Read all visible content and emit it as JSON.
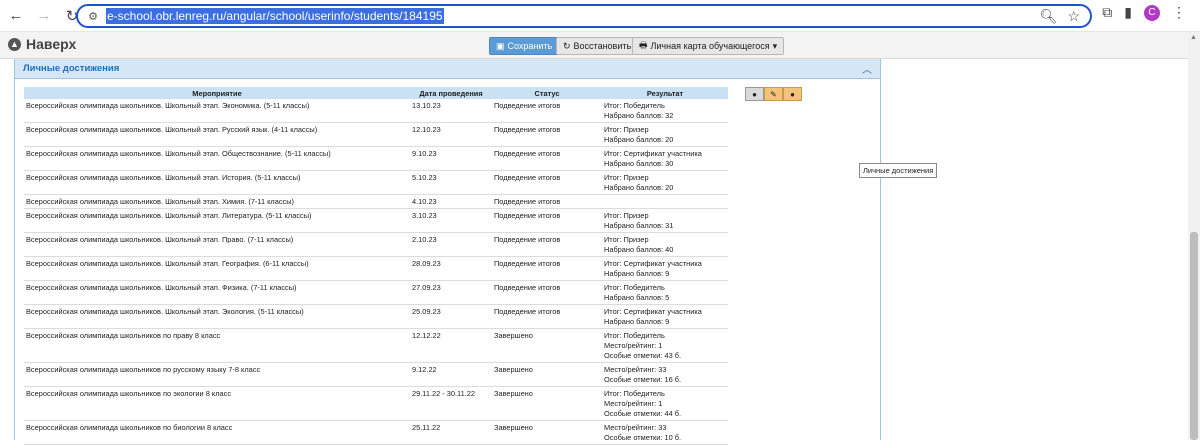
{
  "browser": {
    "url": "e-school.obr.lenreg.ru/angular/school/userinfo/students/184195",
    "avatar_letter": "C"
  },
  "topbar": {
    "back_label": "Наверх",
    "save_label": "Сохранить",
    "restore_label": "Восстановить",
    "card_label": "Личная карта обучающегося"
  },
  "panel": {
    "title": "Личные достижения",
    "columns": [
      "Мероприятие",
      "Дата проведения",
      "Статус",
      "Результат"
    ],
    "rows": [
      {
        "event": "Всероссийская олимпиада школьников. Школьный этап. Экономика. (5-11 классы)",
        "date": "13.10.23",
        "status": "Подведение итогов",
        "result": [
          "Итог: Победитель",
          "Набрано баллов: 32"
        ]
      },
      {
        "event": "Всероссийская олимпиада школьников. Школьный этап. Русский язык. (4-11 классы)",
        "date": "12.10.23",
        "status": "Подведение итогов",
        "result": [
          "Итог: Призер",
          "Набрано баллов: 20"
        ]
      },
      {
        "event": "Всероссийская олимпиада школьников. Школьный этап. Обществознание. (5-11 классы)",
        "date": "9.10.23",
        "status": "Подведение итогов",
        "result": [
          "Итог: Сертификат участника",
          "Набрано баллов: 30"
        ]
      },
      {
        "event": "Всероссийская олимпиада школьников. Школьный этап. История. (5-11 классы)",
        "date": "5.10.23",
        "status": "Подведение итогов",
        "result": [
          "Итог: Призер",
          "Набрано баллов: 20"
        ]
      },
      {
        "event": "Всероссийская олимпиада школьников. Школьный этап. Химия. (7-11 классы)",
        "date": "4.10.23",
        "status": "Подведение итогов",
        "result": []
      },
      {
        "event": "Всероссийская олимпиада школьников. Школьный этап. Литература. (5-11 классы)",
        "date": "3.10.23",
        "status": "Подведение итогов",
        "result": [
          "Итог: Призер",
          "Набрано баллов: 31"
        ]
      },
      {
        "event": "Всероссийская олимпиада школьников. Школьный этап. Право. (7-11 классы)",
        "date": "2.10.23",
        "status": "Подведение итогов",
        "result": [
          "Итог: Призер",
          "Набрано баллов: 40"
        ]
      },
      {
        "event": "Всероссийская олимпиада школьников. Школьный этап. География. (6-11 классы)",
        "date": "28.09.23",
        "status": "Подведение итогов",
        "result": [
          "Итог: Сертификат участника",
          "Набрано баллов: 9"
        ]
      },
      {
        "event": "Всероссийская олимпиада школьников. Школьный этап. Физика. (7-11 классы)",
        "date": "27.09.23",
        "status": "Подведение итогов",
        "result": [
          "Итог: Победитель",
          "Набрано баллов: 5"
        ]
      },
      {
        "event": "Всероссийская олимпиада школьников. Школьный этап. Экология. (5-11 классы)",
        "date": "25.09.23",
        "status": "Подведение итогов",
        "result": [
          "Итог: Сертификат участника",
          "Набрано баллов: 9"
        ]
      },
      {
        "event": "Всероссийская олимпиада школьников по праву 8 класс",
        "date": "12.12.22",
        "status": "Завершено",
        "result": [
          "Итог: Победитель",
          "Место/рейтинг: 1",
          "Особые отметки: 43 б."
        ]
      },
      {
        "event": "Всероссийская олимпиада школьников по русскому языку 7-8 класс",
        "date": "9.12.22",
        "status": "Завершено",
        "result": [
          "Место/рейтинг: 33",
          "Особые отметки: 16 б."
        ]
      },
      {
        "event": "Всероссийская олимпиада школьников по экологии 8 класс",
        "date": "29.11.22 - 30.11.22",
        "status": "Завершено",
        "result": [
          "Итог: Победитель",
          "Место/рейтинг: 1",
          "Особые отметки: 44 б."
        ]
      },
      {
        "event": "Всероссийская олимпиада школьников по биологии 8 класс",
        "date": "25.11.22",
        "status": "Завершено",
        "result": [
          "Место/рейтинг: 33",
          "Особые отметки: 10 б."
        ]
      }
    ]
  },
  "tooltip": "Личные достижения",
  "colors": {
    "accent": "#1f6fb2",
    "header_bg": "#d5e7f5",
    "save_bg": "#5b9bd5"
  }
}
